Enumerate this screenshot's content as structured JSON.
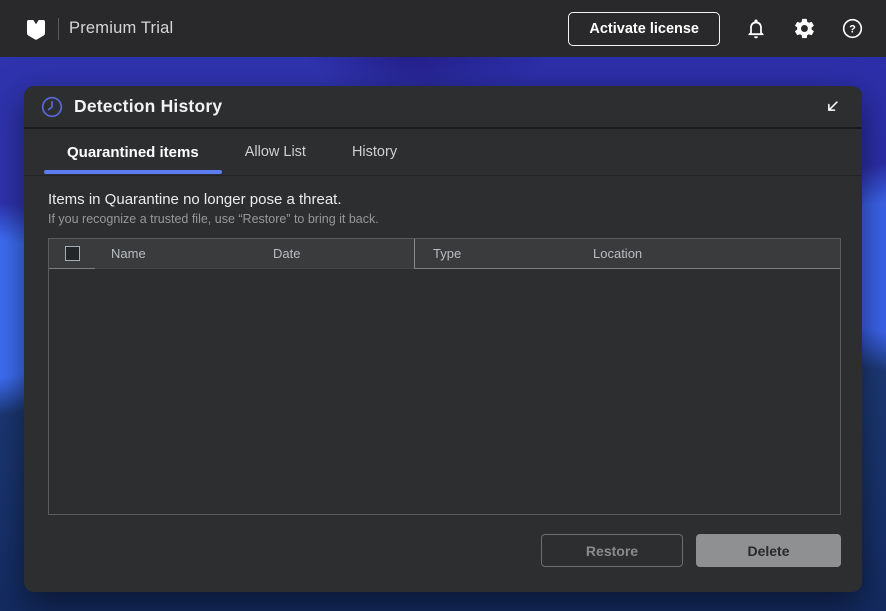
{
  "topbar": {
    "product_name": "Premium Trial",
    "activate_button_label": "Activate license"
  },
  "panel": {
    "title": "Detection History",
    "tabs": [
      {
        "label": "Quarantined items",
        "active": true
      },
      {
        "label": "Allow List",
        "active": false
      },
      {
        "label": "History",
        "active": false
      }
    ],
    "description_heading": "Items in Quarantine no longer pose a threat.",
    "description_subtext": "If you recognize a trusted file, use “Restore” to bring it back.",
    "table": {
      "columns": [
        "Name",
        "Date",
        "Type",
        "Location"
      ],
      "rows": [],
      "select_all_checked": false
    },
    "buttons": {
      "restore_label": "Restore",
      "restore_enabled": false,
      "delete_label": "Delete",
      "delete_enabled": true
    }
  },
  "icons": {
    "topbar": [
      "malwarebytes-logo",
      "bell-icon",
      "gear-icon",
      "help-icon"
    ],
    "panel": [
      "clock-icon",
      "collapse-arrow-icon"
    ]
  },
  "colors": {
    "accent_blue": "#5c7cf2",
    "clock_icon_blue": "#5a68de",
    "topbar_bg": "#29292b",
    "panel_bg": "#2c2e30",
    "table_header_bg": "#3a3b3c",
    "background_indigo": "#2d30ad",
    "background_navy": "#1a356f",
    "bright_wave_blue": "#3d6ef5",
    "delete_button_bg": "#8e9091"
  }
}
